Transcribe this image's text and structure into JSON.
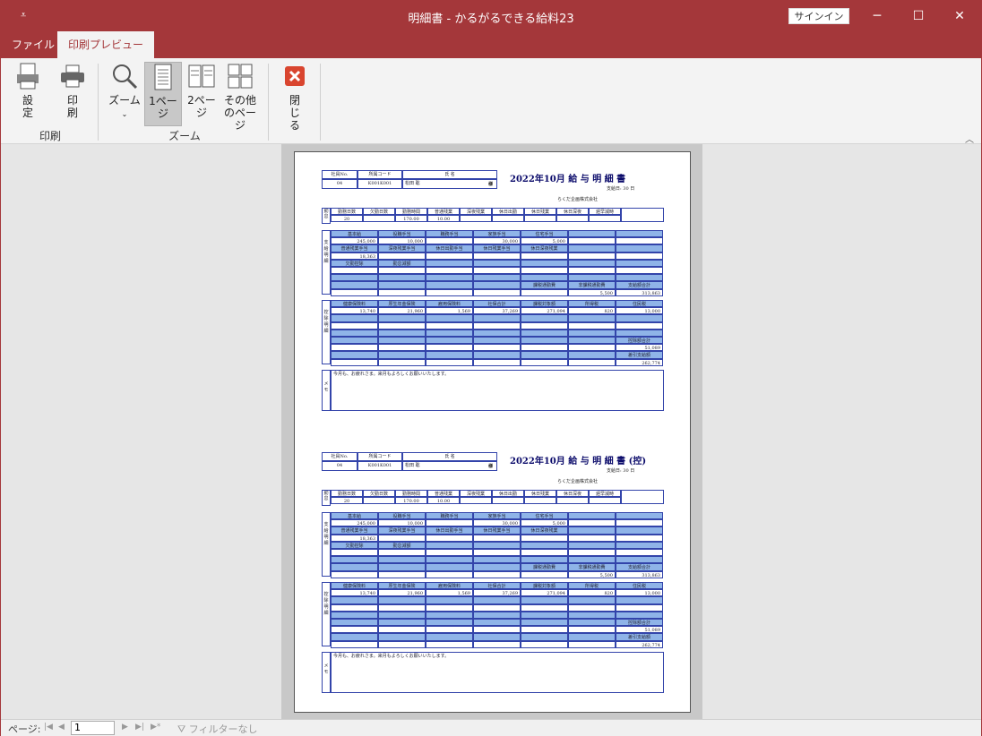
{
  "window": {
    "title": "明細書 - かるがるできる給料23",
    "signin": "サインイン",
    "qat": "₹",
    "minimize": "─",
    "maximize": "☐",
    "close": "✕"
  },
  "tabs": [
    {
      "label": "ファイル"
    },
    {
      "label": "印刷プレビュー"
    }
  ],
  "ribbon": {
    "setup": "設定",
    "print": "印刷",
    "group_print": "印刷",
    "zoom": "ズーム",
    "one_page": "1ページ",
    "two_page": "2ページ",
    "more_pages": "その他のページ",
    "group_zoom": "ズーム",
    "close": "閉じる"
  },
  "status": {
    "page_label": "ページ:",
    "page_value": "1",
    "filter": "フィルターなし"
  },
  "slips": [
    {
      "title": "2022年10月 給 与 明 細 書",
      "paydate": "支給日: 30 日",
      "company": "らくだ企画株式会社"
    },
    {
      "title": "2022年10月 給 与 明 細 書 (控)",
      "paydate": "支給日: 30 日",
      "company": "らくだ企画株式会社"
    }
  ],
  "employee": {
    "h_no": "社員No.",
    "h_dept": "所属コード",
    "h_name": "氏 名",
    "no": "04",
    "dept": "K001K001",
    "name": "松田 聡",
    "seal": "様"
  },
  "attendance": {
    "side": "勤怠",
    "headers": [
      "勤務日数",
      "欠勤日数",
      "勤務時間",
      "普通残業",
      "深夜残業",
      "休日出勤",
      "休日残業",
      "休日深夜",
      "遅早減時"
    ],
    "values": [
      "20",
      "",
      "170.00",
      "10.00",
      "",
      "",
      "",
      "",
      ""
    ]
  },
  "pay": {
    "side": "支給明細",
    "r1": [
      "基本給",
      "役職手当",
      "職務手当",
      "家族手当",
      "住宅手当",
      "",
      ""
    ],
    "v1": [
      "245,000",
      "10,000",
      "",
      "30,000",
      "5,000",
      "",
      ""
    ],
    "r2": [
      "普通残業手当",
      "深夜残業手当",
      "休日出勤手当",
      "休日残業手当",
      "休日深夜残業",
      "",
      ""
    ],
    "v2": [
      "18,363",
      "",
      "",
      "",
      "",
      "",
      ""
    ],
    "r3": [
      "欠勤控除",
      "勤怠減額",
      "",
      "",
      "",
      "",
      ""
    ],
    "r5": [
      "",
      "",
      "",
      "",
      "課税通勤費",
      "非課税通勤費",
      "支給額合計"
    ],
    "v5": [
      "",
      "",
      "",
      "",
      "",
      "5,500",
      "313,863"
    ]
  },
  "ded": {
    "side": "控除明細",
    "r1": [
      "健康保険料",
      "厚生年金保険",
      "雇用保険料",
      "社保合計",
      "課税対象額",
      "所得税",
      "住民税"
    ],
    "v1": [
      "13,740",
      "21,960",
      "1,569",
      "37,269",
      "271,094",
      "820",
      "13,000"
    ],
    "total_label": "控除額合計",
    "total": "51,089",
    "net_label": "差引支給額",
    "net": "262,774"
  },
  "memo": {
    "side": "メモ",
    "text": "今月も、お疲れさま。来月もよろしくお願いいたします。"
  }
}
